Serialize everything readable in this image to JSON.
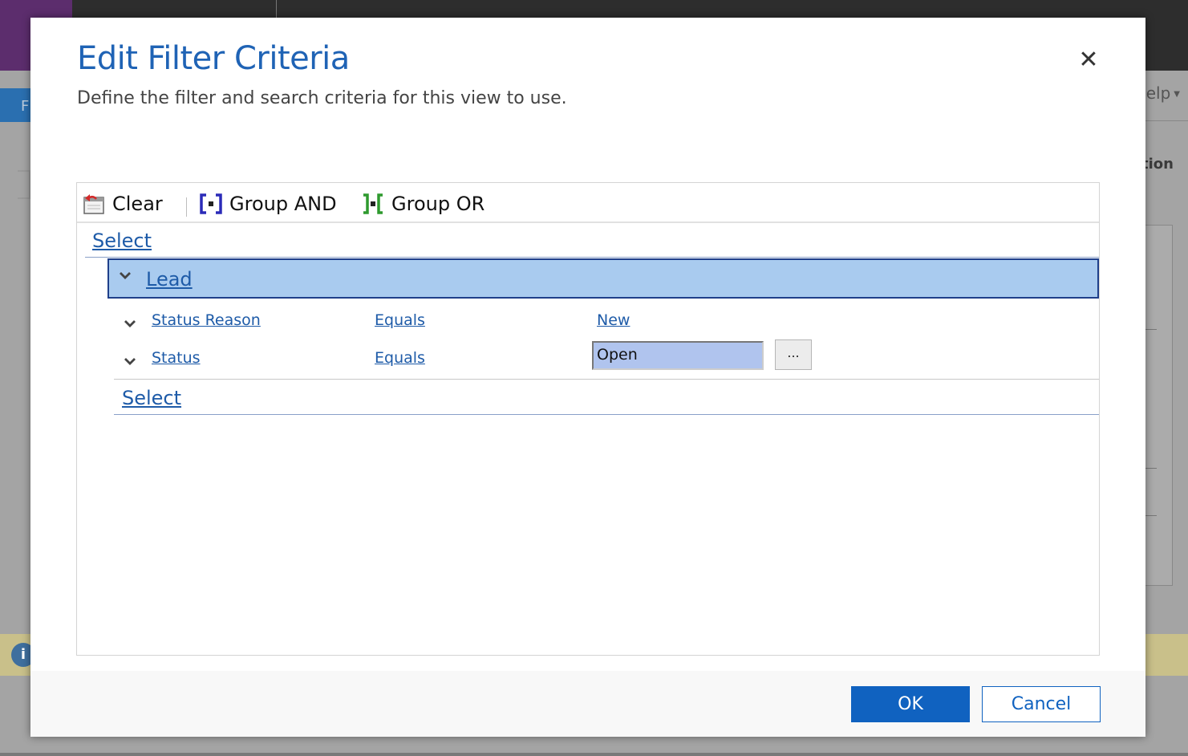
{
  "background": {
    "tab_label": "F",
    "help_label": "elp",
    "section_label": "tion",
    "info_symbol": "i"
  },
  "dialog": {
    "title": "Edit Filter Criteria",
    "subtitle": "Define the filter and search criteria for this view to use.",
    "close_symbol": "✕"
  },
  "toolbar": {
    "clear_label": "Clear",
    "group_and_label": "Group AND",
    "group_or_label": "Group OR"
  },
  "criteria": {
    "select_top": "Select",
    "group": {
      "label": "Lead"
    },
    "conditions": [
      {
        "field": "Status Reason",
        "operator": "Equals",
        "value": "New"
      },
      {
        "field": "Status",
        "operator": "Equals",
        "value": "Open",
        "lookup_label": "..."
      }
    ],
    "select_inner": "Select"
  },
  "footer": {
    "ok_label": "OK",
    "cancel_label": "Cancel"
  },
  "colors": {
    "accent": "#1062c0",
    "title": "#1f63b5",
    "group_highlight": "#a9cbef",
    "input_highlight": "#b0c4ee"
  }
}
